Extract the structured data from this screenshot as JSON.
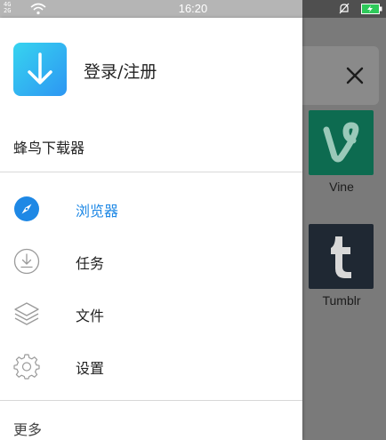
{
  "status_bar": {
    "signal_text": "4G\n2G",
    "time": "16:20"
  },
  "drawer": {
    "login_label": "登录/注册",
    "app_name": "蜂鸟下载器",
    "menu": [
      {
        "label": "浏览器",
        "icon": "compass-icon",
        "active": true
      },
      {
        "label": "任务",
        "icon": "download-circle-icon",
        "active": false
      },
      {
        "label": "文件",
        "icon": "layers-icon",
        "active": false
      },
      {
        "label": "设置",
        "icon": "gear-icon",
        "active": false
      }
    ],
    "more_label": "更多"
  },
  "background": {
    "apps": [
      {
        "name": "Vine",
        "color": "#0d6b50"
      },
      {
        "name": "Tumblr",
        "color": "#1f2833"
      }
    ]
  },
  "colors": {
    "accent": "#1e88e5",
    "logo_gradient_start": "#37d4f0",
    "logo_gradient_end": "#2d96f2"
  }
}
